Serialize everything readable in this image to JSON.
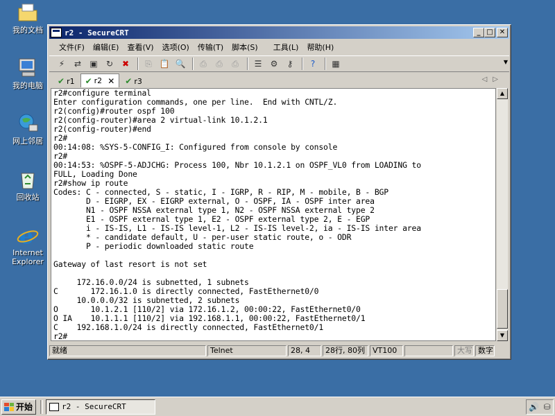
{
  "desktop": {
    "icons": [
      {
        "label": "我的文档",
        "icon": "folder-icon"
      },
      {
        "label": "我的电脑",
        "icon": "computer-icon"
      },
      {
        "label": "网上邻居",
        "icon": "network-icon"
      },
      {
        "label": "回收站",
        "icon": "recycle-bin-icon"
      },
      {
        "label": "Internet Explorer",
        "icon": "ie-icon"
      }
    ]
  },
  "window": {
    "title": "r2 - SecureCRT",
    "controls": {
      "minimize": "_",
      "maximize": "□",
      "close": "✕"
    }
  },
  "menubar": {
    "items": [
      "文件(F)",
      "编辑(E)",
      "查看(V)",
      "选项(O)",
      "传输(T)",
      "脚本(S)",
      "工具(L)",
      "帮助(H)"
    ]
  },
  "tabs": [
    {
      "label": "r1",
      "active": false
    },
    {
      "label": "r2",
      "active": true
    },
    {
      "label": "r3",
      "active": false
    }
  ],
  "terminal": {
    "lines": [
      "r2#configure terminal",
      "Enter configuration commands, one per line.  End with CNTL/Z.",
      "r2(config)#router ospf 100",
      "r2(config-router)#area 2 virtual-link 10.1.2.1",
      "r2(config-router)#end",
      "r2#",
      "00:14:08: %SYS-5-CONFIG_I: Configured from console by console",
      "r2#",
      "00:14:53: %OSPF-5-ADJCHG: Process 100, Nbr 10.1.2.1 on OSPF_VL0 from LOADING to",
      "FULL, Loading Done",
      "r2#show ip route",
      "Codes: C - connected, S - static, I - IGRP, R - RIP, M - mobile, B - BGP",
      "       D - EIGRP, EX - EIGRP external, O - OSPF, IA - OSPF inter area",
      "       N1 - OSPF NSSA external type 1, N2 - OSPF NSSA external type 2",
      "       E1 - OSPF external type 1, E2 - OSPF external type 2, E - EGP",
      "       i - IS-IS, L1 - IS-IS level-1, L2 - IS-IS level-2, ia - IS-IS inter area",
      "       * - candidate default, U - per-user static route, o - ODR",
      "       P - periodic downloaded static route",
      "",
      "Gateway of last resort is not set",
      "",
      "     172.16.0.0/24 is subnetted, 1 subnets",
      "C       172.16.1.0 is directly connected, FastEthernet0/0",
      "     10.0.0.0/32 is subnetted, 2 subnets",
      "O       10.1.2.1 [110/2] via 172.16.1.2, 00:00:22, FastEthernet0/0",
      "O IA    10.1.1.1 [110/2] via 192.168.1.1, 00:00:22, FastEthernet0/1",
      "C    192.168.1.0/24 is directly connected, FastEthernet0/1",
      "r2#"
    ]
  },
  "statusbar": {
    "ready": "就绪",
    "protocol": "Telnet",
    "cursor": "28,  4",
    "size": "28行, 80列",
    "emulation": "VT100",
    "caps": "大写",
    "num": "数字"
  },
  "taskbar": {
    "start_label": "开始",
    "task_label": "r2 - SecureCRT"
  }
}
